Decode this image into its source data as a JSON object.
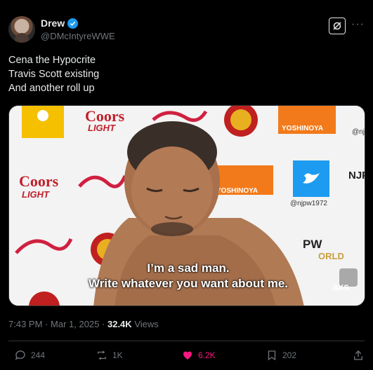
{
  "author": {
    "display_name": "Drew",
    "handle": "@DMcIntyreWWE",
    "verified": true,
    "avatar_icon": "avatar-photo"
  },
  "tweet": {
    "lines": [
      "Cena the Hypocrite",
      "Travis Scott existing",
      "And another roll up"
    ]
  },
  "media": {
    "caption_line1": "I’m a sad man.",
    "caption_line2": "Write whatever you want about me.",
    "watermark": "axs",
    "backdrop_texts": [
      "Coors",
      "LIGHT",
      "Coors",
      "LIGHT",
      "YOSHINOYA",
      "YOSHINOYA",
      "@njpw1972",
      "@njp",
      "NJP",
      "PW",
      "ORLD"
    ]
  },
  "meta": {
    "time": "7:43 PM",
    "separator": "·",
    "date": "Mar 1, 2025",
    "views_count": "32.4K",
    "views_label": "Views"
  },
  "actions": {
    "replies": "244",
    "reposts": "1K",
    "likes": "6.2K",
    "bookmarks": "202"
  },
  "colors": {
    "background": "#000000",
    "text": "#e7e9ea",
    "muted": "#71767b",
    "verified": "#1d9bf0",
    "like": "#f91880",
    "divider": "#2f3336"
  }
}
